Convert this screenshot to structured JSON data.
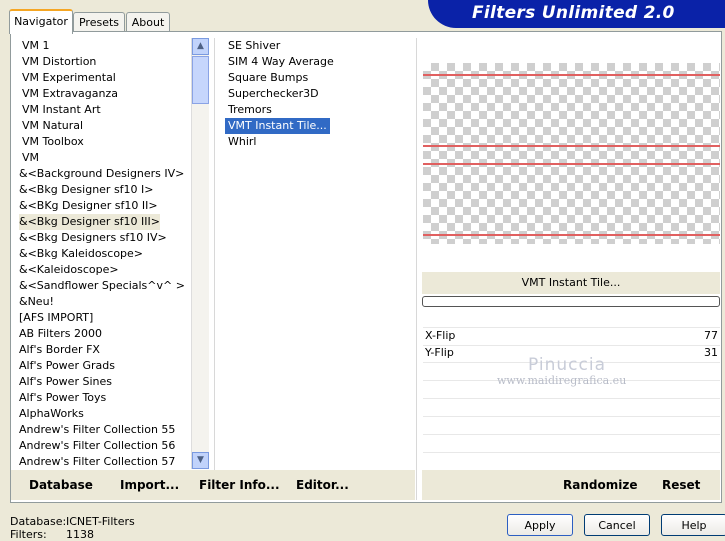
{
  "tabs": [
    "Navigator",
    "Presets",
    "About"
  ],
  "header_title": "Filters Unlimited 2.0",
  "categories": [
    "VM 1",
    "VM Distortion",
    "VM Experimental",
    "VM Extravaganza",
    "VM Instant Art",
    "VM Natural",
    "VM Toolbox",
    "VM",
    "&<Background Designers IV>",
    "&<Bkg Designer sf10 I>",
    "&<BKg Designer sf10 II>",
    "&<Bkg Designer sf10 III>",
    "&<Bkg Designers sf10 IV>",
    "&<Bkg Kaleidoscope>",
    "&<Kaleidoscope>",
    "&<Sandflower Specials^v^ >",
    "&Neu!",
    "[AFS IMPORT]",
    "AB Filters 2000",
    "Alf's Border FX",
    "Alf's Power Grads",
    "Alf's Power Sines",
    "Alf's Power Toys",
    "AlphaWorks",
    "Andrew's Filter Collection 55",
    "Andrew's Filter Collection 56",
    "Andrew's Filter Collection 57"
  ],
  "selected_category": "&<Bkg Designer sf10 III>",
  "filters": [
    "SE Shiver",
    "SIM 4 Way Average",
    "Square Bumps",
    "Superchecker3D",
    "Tremors",
    "VMT Instant Tile...",
    "Whirl"
  ],
  "selected_filter": "VMT Instant Tile...",
  "left_buttons": [
    "Database",
    "Import...",
    "Filter Info...",
    "Editor..."
  ],
  "right_buttons": [
    "Randomize",
    "Reset"
  ],
  "filter_name_display": "VMT Instant Tile...",
  "params": [
    {
      "label": "X-Flip",
      "value": "77"
    },
    {
      "label": "Y-Flip",
      "value": "31"
    }
  ],
  "watermark": {
    "line1": "Pinuccia",
    "line2": "www.maidiregrafica.eu"
  },
  "status": {
    "database_label": "Database:",
    "database_value": "ICNET-Filters",
    "filters_label": "Filters:",
    "filters_value": "1138"
  },
  "bottom_buttons": [
    "Apply",
    "Cancel",
    "Help"
  ],
  "colors": {
    "header": "#0a22a8",
    "selection": "#316ac5",
    "preview_lines": "#e06060"
  }
}
